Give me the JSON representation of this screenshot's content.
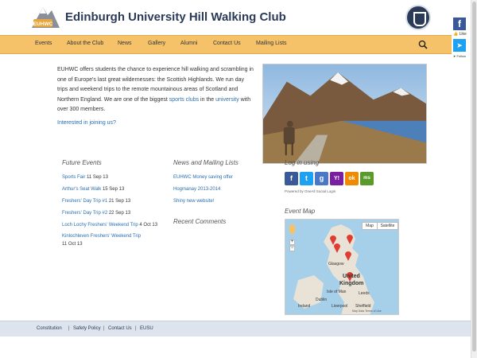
{
  "header": {
    "title": "Edinburgh University Hill Walking Club",
    "logo_text": "EUHWC"
  },
  "nav": {
    "items": [
      "Events",
      "About the Club",
      "News",
      "Gallery",
      "Alumni",
      "Contact Us",
      "Mailing Lists"
    ]
  },
  "social": {
    "like": "Like",
    "follow": "Follow"
  },
  "intro": {
    "text_before": "EUHWC offers students the chance to experience hill walking and scrambling in one of Europe's last great wildernesses: the Scottish Highlands. We run day trips and weekend trips to the remote mountainous areas of Scotland and Northern England. We are one of the biggest ",
    "link_sports": "sports clubs",
    "text_mid": " in the ",
    "link_university": "university",
    "text_after": " with over 300 members.",
    "join": "Interested in joining us?"
  },
  "future_events": {
    "title": "Future Events",
    "items": [
      {
        "name": "Sports Fair",
        "date": "11 Sep 13"
      },
      {
        "name": "Arthur's Seat Walk",
        "date": "15 Sep 13"
      },
      {
        "name": "Freshers' Day Trip #1",
        "date": "21 Sep 13"
      },
      {
        "name": "Freshers' Day Trip #2",
        "date": "22 Sep 13"
      },
      {
        "name": "Loch Lochy Freshers' Weekend Trip",
        "date": "4 Oct 13"
      },
      {
        "name": "Kinlochleven Freshers' Weekend Trip",
        "date": "11 Oct 13"
      }
    ]
  },
  "news": {
    "title": "News and Mailing Lists",
    "items": [
      "EUHWC Money saving offer",
      "Hogmanay 2013-2014",
      "Shiny new website!"
    ],
    "comments_title": "Recent Comments"
  },
  "login": {
    "title": "Log in using",
    "providers": [
      "f",
      "t",
      "g",
      "Y!",
      "ok",
      "ms"
    ],
    "powered": "Powered by OneAll Social Login"
  },
  "map": {
    "title": "Event Map",
    "buttons": [
      "Map",
      "Satellite"
    ],
    "labels": [
      "Glasgow",
      "United",
      "Kingdom",
      "Isle of Man",
      "Leeds",
      "Dublin",
      "Liverpool",
      "Sheffield",
      "Ireland"
    ],
    "footer": "Map Data   Terms of Use"
  },
  "footer": {
    "links": [
      "Constitution",
      "Safety Policy",
      "Contact Us",
      "EUSU"
    ]
  },
  "colors": {
    "nav_bg": "#f5c26a",
    "title": "#2b3a57",
    "link": "#2a6fb0",
    "footer_bg": "#dde4ee"
  }
}
